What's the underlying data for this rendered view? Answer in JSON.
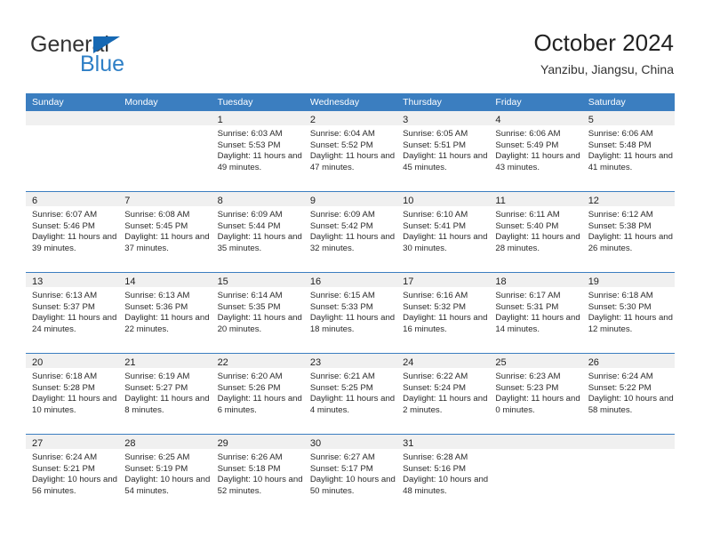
{
  "brand": {
    "name_top": "General",
    "name_bottom": "Blue",
    "triangle_icon": "triangle-icon",
    "accent_color": "#1668b3",
    "secondary_color": "#2e7fc6"
  },
  "header": {
    "title": "October 2024",
    "subtitle": "Yanzibu, Jiangsu, China"
  },
  "calendar": {
    "header_bg": "#3b7ec0",
    "daynum_bg": "#f0f0f0",
    "weekdays": [
      "Sunday",
      "Monday",
      "Tuesday",
      "Wednesday",
      "Thursday",
      "Friday",
      "Saturday"
    ],
    "weeks": [
      [
        {
          "day": "",
          "empty": true
        },
        {
          "day": "",
          "empty": true
        },
        {
          "day": "1",
          "sunrise": "Sunrise: 6:03 AM",
          "sunset": "Sunset: 5:53 PM",
          "daylight": "Daylight: 11 hours and 49 minutes."
        },
        {
          "day": "2",
          "sunrise": "Sunrise: 6:04 AM",
          "sunset": "Sunset: 5:52 PM",
          "daylight": "Daylight: 11 hours and 47 minutes."
        },
        {
          "day": "3",
          "sunrise": "Sunrise: 6:05 AM",
          "sunset": "Sunset: 5:51 PM",
          "daylight": "Daylight: 11 hours and 45 minutes."
        },
        {
          "day": "4",
          "sunrise": "Sunrise: 6:06 AM",
          "sunset": "Sunset: 5:49 PM",
          "daylight": "Daylight: 11 hours and 43 minutes."
        },
        {
          "day": "5",
          "sunrise": "Sunrise: 6:06 AM",
          "sunset": "Sunset: 5:48 PM",
          "daylight": "Daylight: 11 hours and 41 minutes."
        }
      ],
      [
        {
          "day": "6",
          "sunrise": "Sunrise: 6:07 AM",
          "sunset": "Sunset: 5:46 PM",
          "daylight": "Daylight: 11 hours and 39 minutes."
        },
        {
          "day": "7",
          "sunrise": "Sunrise: 6:08 AM",
          "sunset": "Sunset: 5:45 PM",
          "daylight": "Daylight: 11 hours and 37 minutes."
        },
        {
          "day": "8",
          "sunrise": "Sunrise: 6:09 AM",
          "sunset": "Sunset: 5:44 PM",
          "daylight": "Daylight: 11 hours and 35 minutes."
        },
        {
          "day": "9",
          "sunrise": "Sunrise: 6:09 AM",
          "sunset": "Sunset: 5:42 PM",
          "daylight": "Daylight: 11 hours and 32 minutes."
        },
        {
          "day": "10",
          "sunrise": "Sunrise: 6:10 AM",
          "sunset": "Sunset: 5:41 PM",
          "daylight": "Daylight: 11 hours and 30 minutes."
        },
        {
          "day": "11",
          "sunrise": "Sunrise: 6:11 AM",
          "sunset": "Sunset: 5:40 PM",
          "daylight": "Daylight: 11 hours and 28 minutes."
        },
        {
          "day": "12",
          "sunrise": "Sunrise: 6:12 AM",
          "sunset": "Sunset: 5:38 PM",
          "daylight": "Daylight: 11 hours and 26 minutes."
        }
      ],
      [
        {
          "day": "13",
          "sunrise": "Sunrise: 6:13 AM",
          "sunset": "Sunset: 5:37 PM",
          "daylight": "Daylight: 11 hours and 24 minutes."
        },
        {
          "day": "14",
          "sunrise": "Sunrise: 6:13 AM",
          "sunset": "Sunset: 5:36 PM",
          "daylight": "Daylight: 11 hours and 22 minutes."
        },
        {
          "day": "15",
          "sunrise": "Sunrise: 6:14 AM",
          "sunset": "Sunset: 5:35 PM",
          "daylight": "Daylight: 11 hours and 20 minutes."
        },
        {
          "day": "16",
          "sunrise": "Sunrise: 6:15 AM",
          "sunset": "Sunset: 5:33 PM",
          "daylight": "Daylight: 11 hours and 18 minutes."
        },
        {
          "day": "17",
          "sunrise": "Sunrise: 6:16 AM",
          "sunset": "Sunset: 5:32 PM",
          "daylight": "Daylight: 11 hours and 16 minutes."
        },
        {
          "day": "18",
          "sunrise": "Sunrise: 6:17 AM",
          "sunset": "Sunset: 5:31 PM",
          "daylight": "Daylight: 11 hours and 14 minutes."
        },
        {
          "day": "19",
          "sunrise": "Sunrise: 6:18 AM",
          "sunset": "Sunset: 5:30 PM",
          "daylight": "Daylight: 11 hours and 12 minutes."
        }
      ],
      [
        {
          "day": "20",
          "sunrise": "Sunrise: 6:18 AM",
          "sunset": "Sunset: 5:28 PM",
          "daylight": "Daylight: 11 hours and 10 minutes."
        },
        {
          "day": "21",
          "sunrise": "Sunrise: 6:19 AM",
          "sunset": "Sunset: 5:27 PM",
          "daylight": "Daylight: 11 hours and 8 minutes."
        },
        {
          "day": "22",
          "sunrise": "Sunrise: 6:20 AM",
          "sunset": "Sunset: 5:26 PM",
          "daylight": "Daylight: 11 hours and 6 minutes."
        },
        {
          "day": "23",
          "sunrise": "Sunrise: 6:21 AM",
          "sunset": "Sunset: 5:25 PM",
          "daylight": "Daylight: 11 hours and 4 minutes."
        },
        {
          "day": "24",
          "sunrise": "Sunrise: 6:22 AM",
          "sunset": "Sunset: 5:24 PM",
          "daylight": "Daylight: 11 hours and 2 minutes."
        },
        {
          "day": "25",
          "sunrise": "Sunrise: 6:23 AM",
          "sunset": "Sunset: 5:23 PM",
          "daylight": "Daylight: 11 hours and 0 minutes."
        },
        {
          "day": "26",
          "sunrise": "Sunrise: 6:24 AM",
          "sunset": "Sunset: 5:22 PM",
          "daylight": "Daylight: 10 hours and 58 minutes."
        }
      ],
      [
        {
          "day": "27",
          "sunrise": "Sunrise: 6:24 AM",
          "sunset": "Sunset: 5:21 PM",
          "daylight": "Daylight: 10 hours and 56 minutes."
        },
        {
          "day": "28",
          "sunrise": "Sunrise: 6:25 AM",
          "sunset": "Sunset: 5:19 PM",
          "daylight": "Daylight: 10 hours and 54 minutes."
        },
        {
          "day": "29",
          "sunrise": "Sunrise: 6:26 AM",
          "sunset": "Sunset: 5:18 PM",
          "daylight": "Daylight: 10 hours and 52 minutes."
        },
        {
          "day": "30",
          "sunrise": "Sunrise: 6:27 AM",
          "sunset": "Sunset: 5:17 PM",
          "daylight": "Daylight: 10 hours and 50 minutes."
        },
        {
          "day": "31",
          "sunrise": "Sunrise: 6:28 AM",
          "sunset": "Sunset: 5:16 PM",
          "daylight": "Daylight: 10 hours and 48 minutes."
        },
        {
          "day": "",
          "empty": true
        },
        {
          "day": "",
          "empty": true
        }
      ]
    ]
  }
}
